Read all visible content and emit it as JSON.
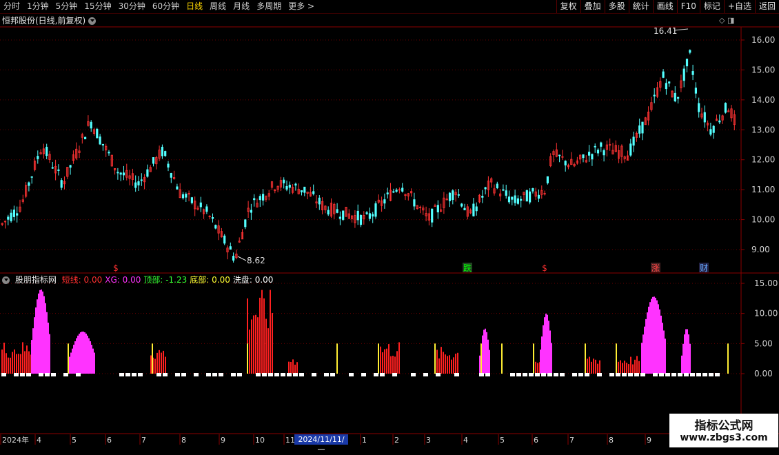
{
  "periods": [
    "分时",
    "1分钟",
    "5分钟",
    "15分钟",
    "30分钟",
    "60分钟",
    "日线",
    "周线",
    "月线",
    "多周期",
    "更多 >"
  ],
  "active_period": "日线",
  "tools": [
    "复权",
    "叠加",
    "多股",
    "统计",
    "画线",
    "F10",
    "标记",
    "+自选",
    "返回"
  ],
  "stock_title": "恒邦股份(日线,前复权)",
  "chart_icons": "◇ ◨",
  "price_axis_ticks": [
    "16.00",
    "15.00",
    "14.00",
    "13.00",
    "12.00",
    "11.00",
    "10.00",
    "9.00"
  ],
  "high_label": "16.41",
  "low_label": "8.62",
  "markers": [
    {
      "text": "$",
      "color": "#ff3030",
      "bg": ""
    },
    {
      "text": "跌",
      "color": "#00ff00",
      "bg": "#224422"
    },
    {
      "text": "$",
      "color": "#ff3030",
      "bg": ""
    },
    {
      "text": "涨",
      "color": "#ff4444",
      "bg": "#442222"
    },
    {
      "text": "财",
      "color": "#66aaff",
      "bg": "#222244"
    }
  ],
  "indicator": {
    "name": "股朋指标网",
    "items": [
      {
        "label": "短线: 0.00",
        "color": "#ff3030"
      },
      {
        "label": "XG: 0.00",
        "color": "#ff33ff"
      },
      {
        "label": "顶部: -1.23",
        "color": "#33ff33"
      },
      {
        "label": "底部: 0.00",
        "color": "#ffff33"
      },
      {
        "label": "洗盘: 0.00",
        "color": "#ffffff"
      }
    ]
  },
  "indicator_axis_ticks": [
    "15.00",
    "10.00",
    "5.00",
    "0.00"
  ],
  "date_axis": [
    "2024年",
    "4",
    "5",
    "6",
    "7",
    "8",
    "9",
    "10",
    "11",
    "1",
    "2",
    "3",
    "4",
    "5",
    "6",
    "7",
    "8",
    "9"
  ],
  "date_cursor": "2024/11/11/一",
  "watermark": {
    "line1": "指标公式网",
    "line2": "www.zbgs3.com"
  },
  "colors": {
    "up": "#ff3333",
    "down": "#54ffff",
    "grid": "#6a0000",
    "axis": "#8b0000"
  }
}
